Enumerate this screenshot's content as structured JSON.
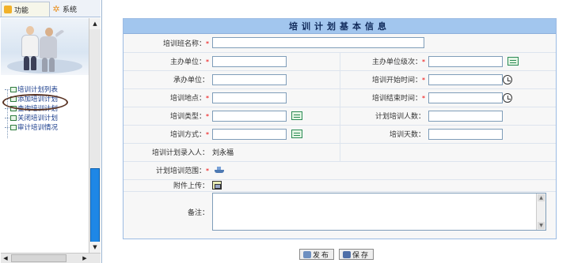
{
  "tabs": [
    {
      "label": "功能",
      "icon": "folder-icon"
    },
    {
      "label": "系统",
      "icon": "gear-icon"
    }
  ],
  "tree": [
    {
      "label": "培训计划列表"
    },
    {
      "label": "添加培训计划"
    },
    {
      "label": "查询培训计划"
    },
    {
      "label": "关闭培训计划"
    },
    {
      "label": "审计培训情况"
    }
  ],
  "form": {
    "title": "培训计划基本信息",
    "rows": {
      "class_name": {
        "label": "培训班名称：",
        "value": ""
      },
      "organizer": {
        "label": "主办单位：",
        "value": ""
      },
      "organizer_level": {
        "label": "主办单位级次：",
        "value": ""
      },
      "undertaker": {
        "label": "承办单位：",
        "value": ""
      },
      "start_time": {
        "label": "培训开始时间：",
        "value": ""
      },
      "location": {
        "label": "培训地点：",
        "value": ""
      },
      "end_time": {
        "label": "培训结束时间：",
        "value": ""
      },
      "type": {
        "label": "培训类型：",
        "value": ""
      },
      "plan_count": {
        "label": "计划培训人数：",
        "value": ""
      },
      "method": {
        "label": "培训方式：",
        "value": ""
      },
      "days": {
        "label": "培训天数：",
        "value": ""
      },
      "entered_by": {
        "label": "培训计划录入人：",
        "value": "刘永福"
      },
      "scope": {
        "label": "计划培训范围："
      },
      "attachment": {
        "label": "附件上传："
      },
      "remarks": {
        "label": "备注：",
        "value": ""
      }
    },
    "required_mark": "*"
  },
  "buttons": {
    "publish": "发布",
    "save": "保存"
  },
  "colors": {
    "title_bar": "#a2c6ee",
    "required": "#e00000",
    "link": "#1a3d8c",
    "scroll_thumb": "#1e87e6"
  }
}
